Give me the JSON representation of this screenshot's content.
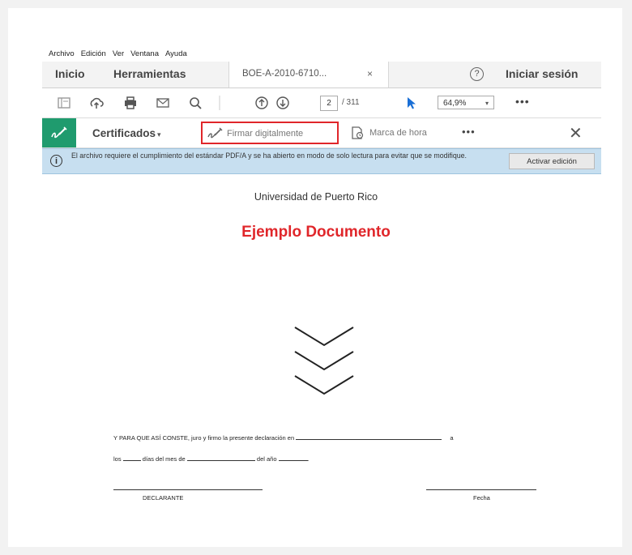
{
  "menu": [
    "Archivo",
    "Edición",
    "Ver",
    "Ventana",
    "Ayuda"
  ],
  "tabs": {
    "inicio": "Inicio",
    "herramientas": "Herramientas",
    "document": "BOE-A-2010-6710...",
    "close": "×",
    "help": "?",
    "signin": "Iniciar sesión"
  },
  "toolbar": {
    "page_current": "2",
    "page_total": "/ 311",
    "zoom": "64,9%",
    "zoom_caret": "▾",
    "more": "•••"
  },
  "certbar": {
    "certificados": "Certificados",
    "caret": "▾",
    "firmar": "Firmar digitalmente",
    "marca": "Marca de hora",
    "more": "•••",
    "close": "✕"
  },
  "info": {
    "icon": "i",
    "text": "El archivo requiere el cumplimiento del estándar PDF/A y se ha abierto en modo de solo lectura para evitar que se modifique.",
    "button": "Activar edición"
  },
  "document": {
    "university": "Universidad de Puerto Rico",
    "title": "Ejemplo Documento",
    "line1_prefix": "Y PARA QUE ASÍ CONSTE, juro y firmo la presente declaración en",
    "line1_suffix": "a",
    "line2_a": "los",
    "line2_b": "días del mes de",
    "line2_c": "del año",
    "line2_d": ".",
    "declarante": "DECLARANTE",
    "fecha": "Fecha"
  },
  "colors": {
    "accent_green": "#1f9b6e",
    "highlight_red": "#e0262a",
    "info_blue": "#c7dff0"
  }
}
